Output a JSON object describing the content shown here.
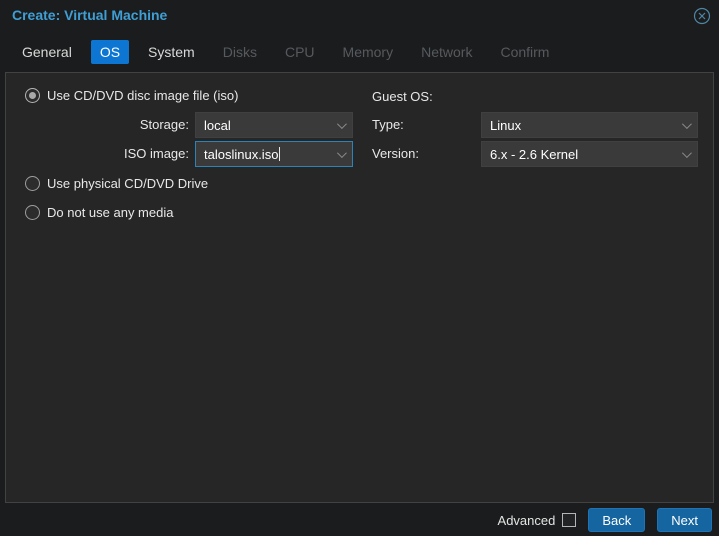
{
  "window": {
    "title": "Create: Virtual Machine",
    "close_icon": "circled-x"
  },
  "tabs": [
    {
      "label": "General",
      "state": "enabled"
    },
    {
      "label": "OS",
      "state": "active"
    },
    {
      "label": "System",
      "state": "enabled"
    },
    {
      "label": "Disks",
      "state": "disabled"
    },
    {
      "label": "CPU",
      "state": "disabled"
    },
    {
      "label": "Memory",
      "state": "disabled"
    },
    {
      "label": "Network",
      "state": "disabled"
    },
    {
      "label": "Confirm",
      "state": "disabled"
    }
  ],
  "media": {
    "radios": [
      {
        "label": "Use CD/DVD disc image file (iso)",
        "selected": true
      },
      {
        "label": "Use physical CD/DVD Drive",
        "selected": false
      },
      {
        "label": "Do not use any media",
        "selected": false
      }
    ],
    "storage": {
      "label": "Storage:",
      "value": "local"
    },
    "iso_image": {
      "label": "ISO image:",
      "value": "taloslinux.iso",
      "focused": true
    }
  },
  "guest_os": {
    "heading": "Guest OS:",
    "type": {
      "label": "Type:",
      "value": "Linux"
    },
    "version": {
      "label": "Version:",
      "value": "6.x - 2.6 Kernel"
    }
  },
  "footer": {
    "advanced_label": "Advanced",
    "advanced_checked": false,
    "back_label": "Back",
    "next_label": "Next"
  },
  "colors": {
    "title_text": "#3f9fd5",
    "active_tab_bg": "#0d76d3",
    "button_bg": "#1565a0",
    "focus_border": "#2e82b5",
    "panel_bg": "#262626",
    "frame_bg": "#1b1c1d",
    "field_bg": "#3a3a3a"
  }
}
